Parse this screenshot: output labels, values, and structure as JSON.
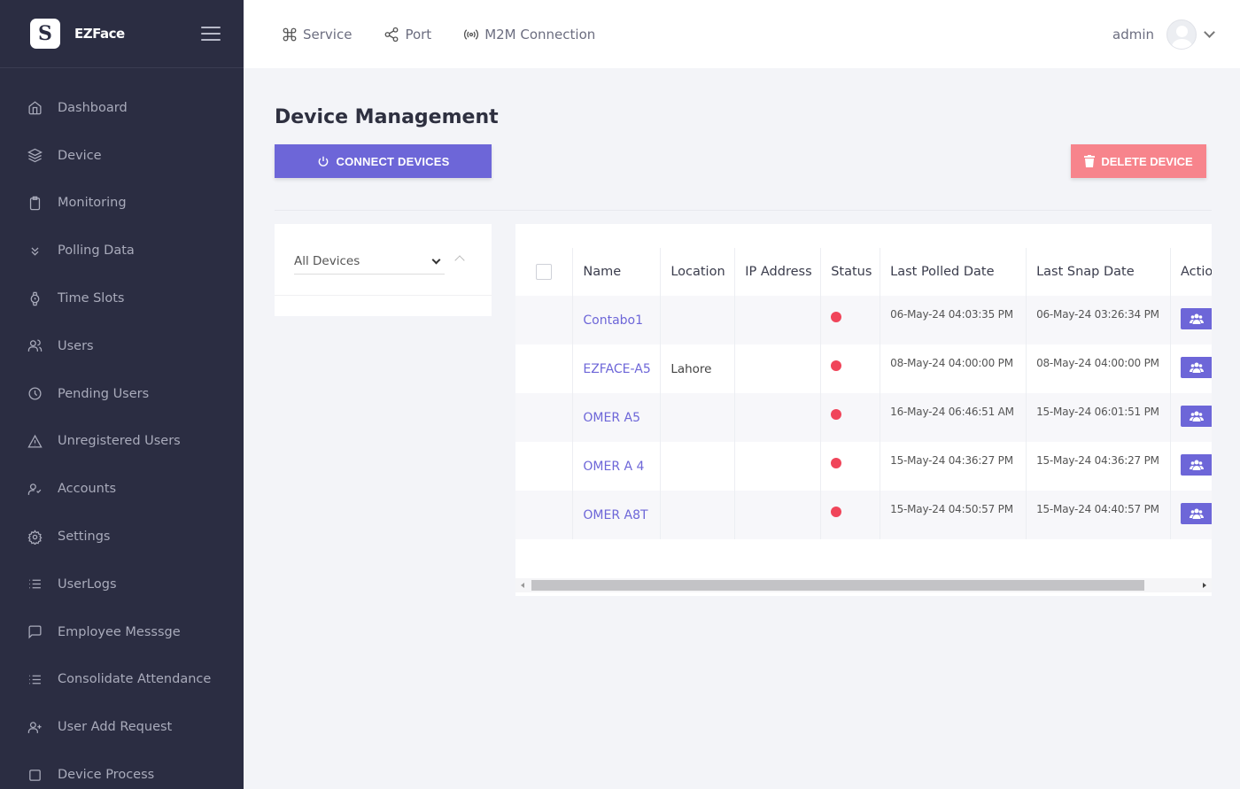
{
  "brand": {
    "logo_letter": "S",
    "name": "EZFace"
  },
  "sidebar": {
    "items": [
      {
        "label": "Dashboard",
        "icon": "home-icon"
      },
      {
        "label": "Device",
        "icon": "layers-icon"
      },
      {
        "label": "Monitoring",
        "icon": "clipboard-icon"
      },
      {
        "label": "Polling Data",
        "icon": "chevrons-down-icon"
      },
      {
        "label": "Time Slots",
        "icon": "watch-icon"
      },
      {
        "label": "Users",
        "icon": "users-icon"
      },
      {
        "label": "Pending Users",
        "icon": "clock-icon"
      },
      {
        "label": "Unregistered Users",
        "icon": "alert-triangle-icon"
      },
      {
        "label": "Accounts",
        "icon": "user-check-icon"
      },
      {
        "label": "Settings",
        "icon": "gear-icon"
      },
      {
        "label": "UserLogs",
        "icon": "list-icon"
      },
      {
        "label": "Employee Messsge",
        "icon": "message-square-icon"
      },
      {
        "label": "Consolidate Attendance",
        "icon": "list-icon"
      },
      {
        "label": "User Add Request",
        "icon": "user-plus-icon"
      },
      {
        "label": "Device Process",
        "icon": "square-icon"
      }
    ]
  },
  "topbar": {
    "links": [
      {
        "label": "Service",
        "icon": "command-icon"
      },
      {
        "label": "Port",
        "icon": "share-icon"
      },
      {
        "label": "M2M Connection",
        "icon": "broadcast-icon"
      }
    ],
    "user": "admin"
  },
  "main": {
    "title": "Device Management",
    "connect_label": "CONNECT DEVICES",
    "delete_label": "DELETE DEVICE",
    "filter": {
      "selected": "All Devices"
    }
  },
  "table": {
    "columns": [
      "Name",
      "Location",
      "IP Address",
      "Status",
      "Last Polled Date",
      "Last Snap Date",
      "Actio"
    ],
    "status_color": "#f0455a",
    "rows": [
      {
        "name": "Contabo1",
        "location": "",
        "ip": "",
        "polled": "06-May-24 04:03:35 PM",
        "snap": "06-May-24 03:26:34 PM"
      },
      {
        "name": "EZFACE-A5",
        "location": "Lahore",
        "ip": "",
        "polled": "08-May-24 04:00:00 PM",
        "snap": "08-May-24 04:00:00 PM"
      },
      {
        "name": "OMER A5",
        "location": "",
        "ip": "",
        "polled": "16-May-24 06:46:51 AM",
        "snap": "15-May-24 06:01:51 PM"
      },
      {
        "name": "OMER A 4",
        "location": "",
        "ip": "",
        "polled": "15-May-24 04:36:27 PM",
        "snap": "15-May-24 04:36:27 PM"
      },
      {
        "name": "OMER A8T",
        "location": "",
        "ip": "",
        "polled": "15-May-24 04:50:57 PM",
        "snap": "15-May-24 04:40:57 PM"
      }
    ]
  }
}
